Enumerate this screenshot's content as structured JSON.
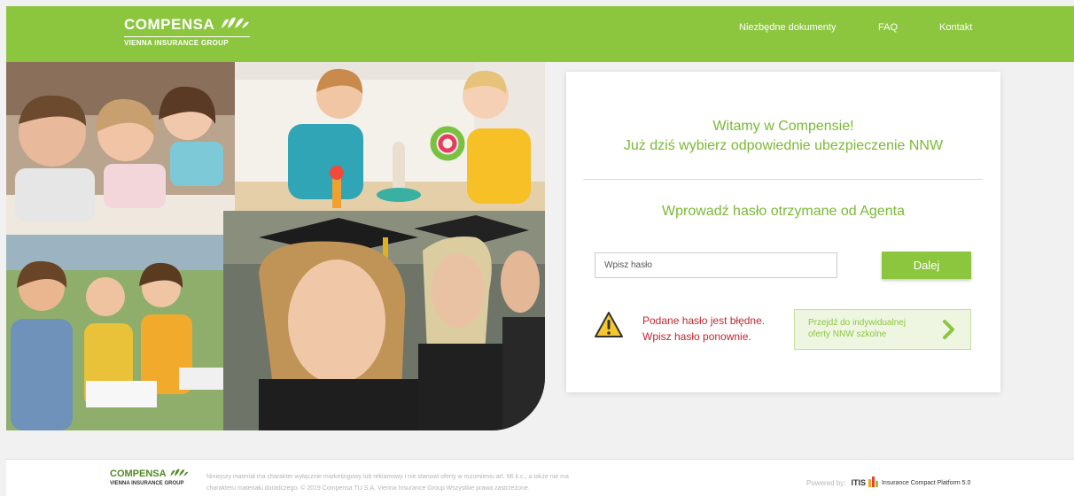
{
  "header": {
    "logo_main": "COMPENSA",
    "logo_sub": "VIENNA INSURANCE GROUP",
    "nav": [
      "Niezbędne dokumenty",
      "FAQ",
      "Kontakt"
    ]
  },
  "card": {
    "welcome_line1": "Witamy w Compensie!",
    "welcome_line2": "Już dziś wybierz odpowiednie ubezpieczenie NNW",
    "prompt": "Wprowadź hasło otrzymane od Agenta",
    "password_placeholder": "Wpisz hasło",
    "next_label": "Dalej",
    "error_line1": "Podane hasło jest błędne.",
    "error_line2": "Wpisz hasło ponownie.",
    "offer_label": "Przejdź do indywidualnej oferty NNW szkolne"
  },
  "footer": {
    "logo_main": "COMPENSA",
    "logo_sub": "VIENNA INSURANCE GROUP",
    "disclaimer_line1": "Niniejszy materiał ma charakter wyłącznie marketingowy lub reklamowy i nie stanowi oferty w rozumieniu art. 66 k.c., a także nie ma",
    "disclaimer_line2": "charakteru materiału doradczego. © 2019 Compensa TU S.A. Vienna Insurance Group Wszystkie prawa zastrzeżone.",
    "powered_by": "Powered by:",
    "itis": "ITIS",
    "platform": "Insurance Compact Platform 5.0"
  },
  "colors": {
    "brand_green": "#8cc63f",
    "text_green": "#7ab935",
    "error_red": "#c0272d"
  },
  "icons": [
    "compensa-logo-icon",
    "warning-icon",
    "chevron-right-icon",
    "itis-logo-icon"
  ]
}
